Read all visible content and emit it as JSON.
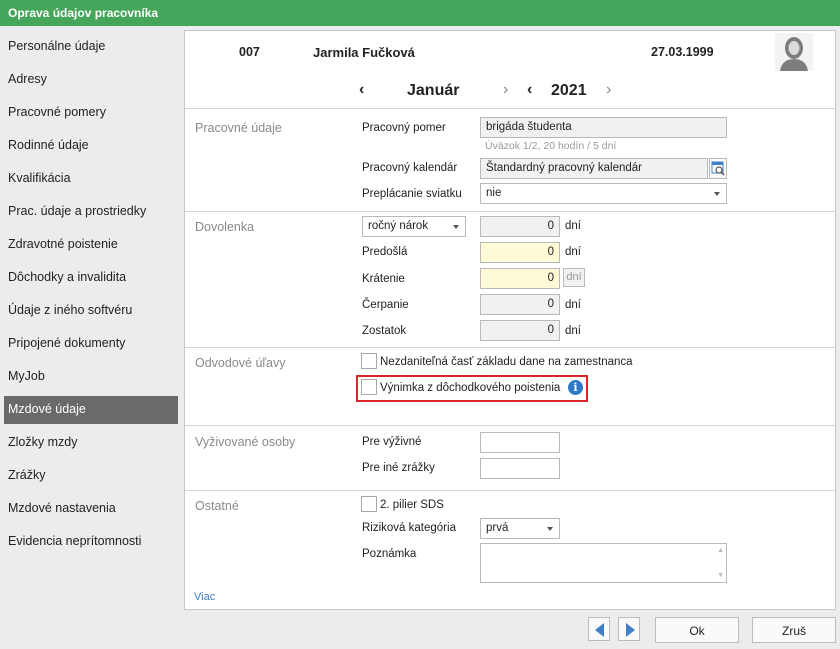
{
  "window": {
    "title": "Oprava údajov pracovníka"
  },
  "sidebar": {
    "items": [
      {
        "label": "Personálne údaje"
      },
      {
        "label": "Adresy"
      },
      {
        "label": "Pracovné pomery"
      },
      {
        "label": "Rodinné údaje"
      },
      {
        "label": "Kvalifikácia"
      },
      {
        "label": "Prac. údaje a prostriedky"
      },
      {
        "label": "Zdravotné poistenie"
      },
      {
        "label": "Dôchodky a invalidita"
      },
      {
        "label": "Údaje z iného softvéru"
      },
      {
        "label": "Pripojené dokumenty"
      },
      {
        "label": "MyJob"
      },
      {
        "label": "Mzdové údaje",
        "active": true
      },
      {
        "label": "Zložky mzdy"
      },
      {
        "label": "Zrážky"
      },
      {
        "label": "Mzdové nastavenia"
      },
      {
        "label": "Evidencia neprítomnosti"
      }
    ]
  },
  "employee": {
    "id": "007",
    "name": "Jarmila Fučková",
    "birth_date": "27.03.1999",
    "avatar_icon": "person-female-icon"
  },
  "period": {
    "month": "Január",
    "year": "2021"
  },
  "work": {
    "section": "Pracovné údaje",
    "pomer_label": "Pracovný pomer",
    "pomer_value": "brigáda študenta",
    "uvazok": "Úväzok 1/2, 20 hodín  / 5 dní",
    "kalendar_label": "Pracovný kalendár",
    "kalendar_value": "Štandardný pracovný kalendár",
    "sviatok_label": "Preplácanie sviatku",
    "sviatok_value": "nie"
  },
  "vacation": {
    "section": "Dovolenka",
    "type_value": "ročný nárok",
    "type_amount": "0",
    "unit": "dní",
    "predosla_label": "Predošlá",
    "predosla_value": "0",
    "kratenie_label": "Krátenie",
    "kratenie_value": "0",
    "cerpanie_label": "Čerpanie",
    "cerpanie_value": "0",
    "zostatok_label": "Zostatok",
    "zostatok_value": "0"
  },
  "relief": {
    "section": "Odvodové úľavy",
    "nezdanitelna_label": "Nezdaniteľná časť základu dane na zamestnanca",
    "vynimka_label": "Výnimka z dôchodkového poistenia",
    "highlight_color": "#d9262a"
  },
  "dependents": {
    "section": "Vyživované osoby",
    "vyzivne_label": "Pre výživné",
    "ine_label": "Pre iné zrážky"
  },
  "other": {
    "section": "Ostatné",
    "pilier_label": "2. pilier SDS",
    "riziko_label": "Riziková kategória",
    "riziko_value": "prvá",
    "poznamka_label": "Poznámka"
  },
  "more_link": "Viac",
  "footer": {
    "ok_label": "Ok",
    "cancel_label": "Zruš"
  },
  "colors": {
    "title_bar": "#45a55a",
    "accent": "#3f7fc8",
    "sidebar_active": "#6a6a6a"
  }
}
